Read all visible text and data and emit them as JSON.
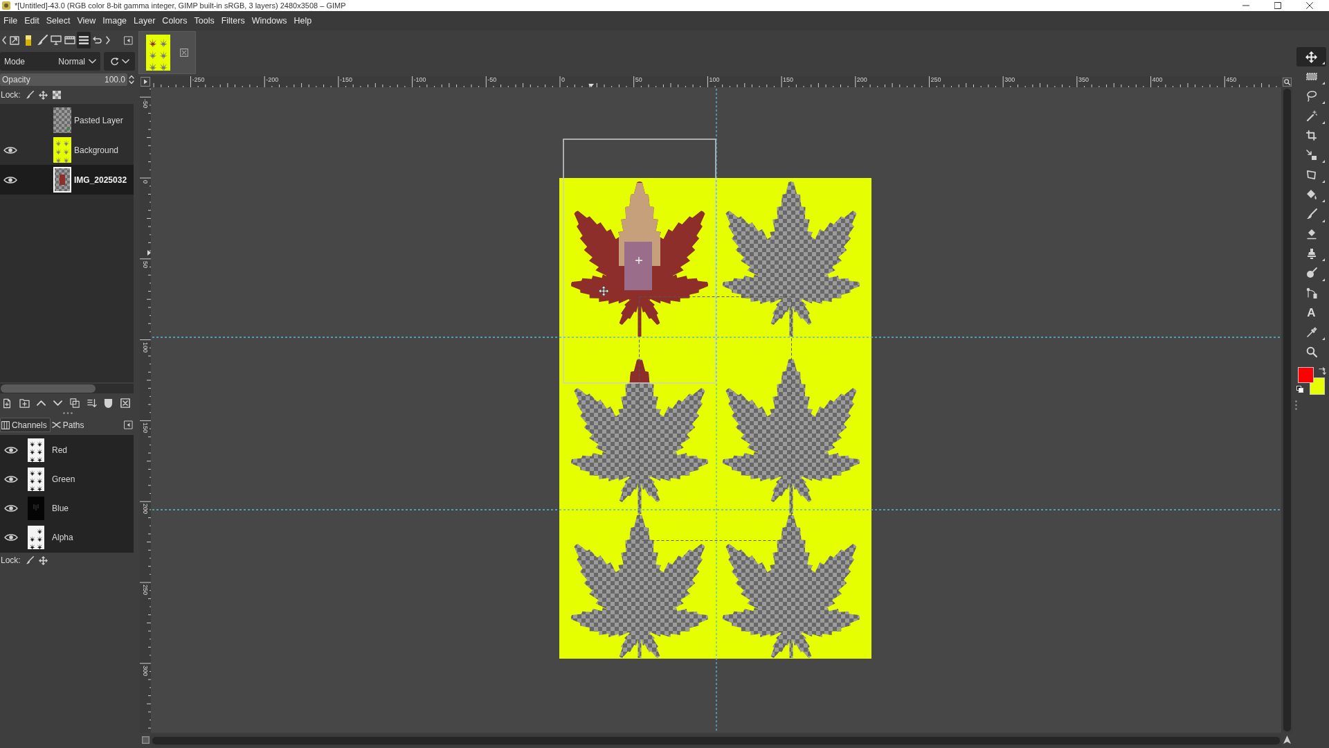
{
  "window": {
    "title": "*[Untitled]-43.0 (RGB color 8-bit gamma integer, GIMP built-in sRGB, 3 layers) 2480x3508 – GIMP"
  },
  "menu": [
    "File",
    "Edit",
    "Select",
    "View",
    "Image",
    "Layer",
    "Colors",
    "Tools",
    "Filters",
    "Windows",
    "Help"
  ],
  "dock_tabs": [
    {
      "kind": "tool-options",
      "selected": false
    },
    {
      "kind": "gradients",
      "selected": false
    },
    {
      "kind": "brushes",
      "selected": false
    },
    {
      "kind": "devices",
      "selected": false
    },
    {
      "kind": "images",
      "selected": false
    },
    {
      "kind": "layers",
      "selected": true
    },
    {
      "kind": "undo",
      "selected": false
    }
  ],
  "image_tabs": [
    {
      "selected": true
    }
  ],
  "layers_panel": {
    "mode": {
      "label": "Mode",
      "value": "Normal"
    },
    "opacity": {
      "label": "Opacity",
      "value": "100.0",
      "level": 1
    },
    "lock_label": "Lock:",
    "layers": [
      {
        "name": "Pasted Layer",
        "visible": false,
        "selected": false,
        "kind": "transparent"
      },
      {
        "name": "Background",
        "visible": true,
        "selected": false,
        "kind": "leaves"
      },
      {
        "name": "IMG_2025032",
        "visible": true,
        "selected": true,
        "kind": "photo"
      }
    ]
  },
  "channels_panel": {
    "tabs": [
      {
        "label": "Channels",
        "kind": "channels",
        "selected": true
      },
      {
        "label": "Paths",
        "kind": "paths",
        "selected": false
      }
    ],
    "channels": [
      {
        "name": "Red",
        "visible": true,
        "kind": "light"
      },
      {
        "name": "Green",
        "visible": true,
        "kind": "light"
      },
      {
        "name": "Blue",
        "visible": true,
        "kind": "dark"
      },
      {
        "name": "Alpha",
        "visible": true,
        "kind": "mask"
      }
    ],
    "lock_label": "Lock:"
  },
  "rulers": {
    "horizontal": [
      "-250",
      "-200",
      "-150",
      "-100",
      "-50",
      "0",
      "50",
      "100",
      "150",
      "200",
      "250",
      "300",
      "350",
      "400",
      "450"
    ],
    "vertical": [
      "-50",
      "0",
      "50",
      "100",
      "150",
      "200",
      "250",
      "300"
    ]
  },
  "canvas": {
    "cells": [
      {
        "kind": "photo"
      },
      {
        "kind": "cutout"
      },
      {
        "kind": "cutout-tip"
      },
      {
        "kind": "cutout"
      },
      {
        "kind": "cutout"
      },
      {
        "kind": "cutout"
      }
    ]
  },
  "toolbox": {
    "tools": [
      {
        "kind": "move",
        "selected": true,
        "grouped": true
      },
      {
        "kind": "rect-select",
        "selected": false,
        "grouped": true
      },
      {
        "kind": "lasso",
        "selected": false,
        "grouped": true
      },
      {
        "kind": "wand",
        "selected": false,
        "grouped": true
      },
      {
        "kind": "crop",
        "selected": false,
        "grouped": false
      },
      {
        "kind": "transform",
        "selected": false,
        "grouped": true
      },
      {
        "kind": "perspective",
        "selected": false,
        "grouped": true
      },
      {
        "kind": "bucket",
        "selected": false,
        "grouped": true
      },
      {
        "kind": "brush",
        "selected": false,
        "grouped": true
      },
      {
        "kind": "eraser",
        "selected": false,
        "grouped": false
      },
      {
        "kind": "clone",
        "selected": false,
        "grouped": true
      },
      {
        "kind": "dodge",
        "selected": false,
        "grouped": true
      },
      {
        "kind": "paths",
        "selected": false,
        "grouped": false
      },
      {
        "kind": "text",
        "selected": false,
        "grouped": false,
        "glyph": "A"
      },
      {
        "kind": "picker",
        "selected": false,
        "grouped": true
      },
      {
        "kind": "zoom",
        "selected": false,
        "grouped": false
      }
    ],
    "colors": [
      {
        "kind": "background",
        "color": "#e6ff00"
      },
      {
        "kind": "foreground",
        "color": "#ff0000"
      }
    ]
  }
}
